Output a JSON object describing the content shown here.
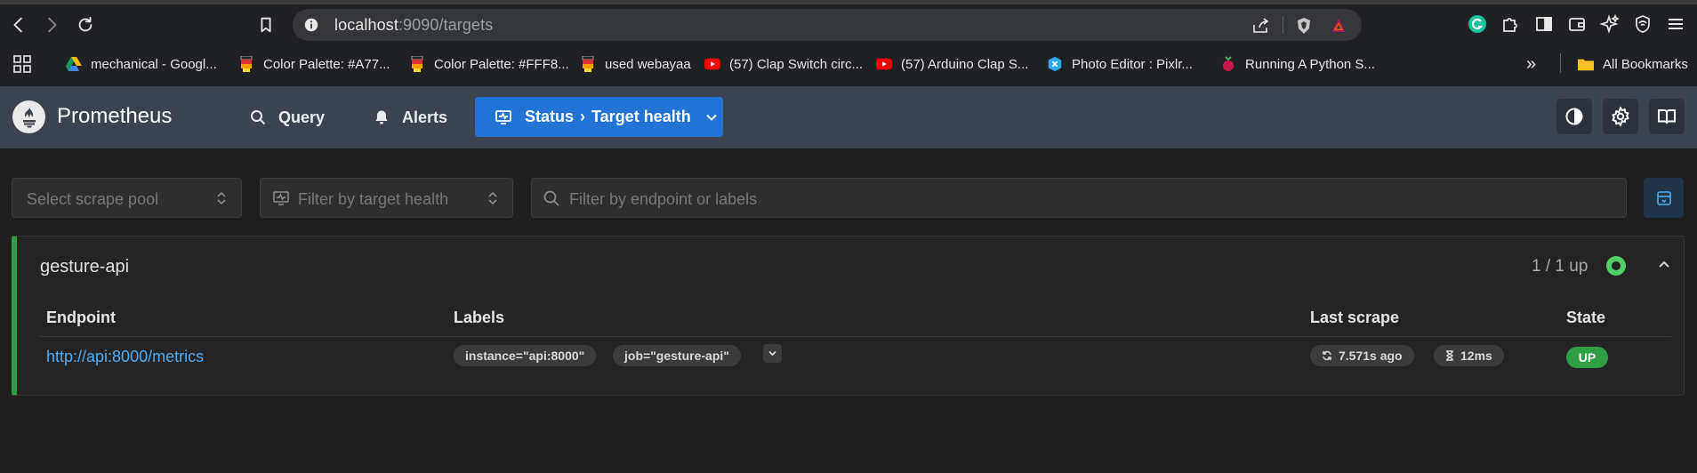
{
  "browser": {
    "url_host": "localhost",
    "url_rest": ":9090/targets",
    "bookmarks": [
      {
        "label": "mechanical - Googl...",
        "icon": "google-drive-icon"
      },
      {
        "label": "Color Palette: #A77...",
        "icon": "palette-icon"
      },
      {
        "label": "Color Palette: #FFF8...",
        "icon": "palette-icon"
      },
      {
        "label": "used webayaa",
        "icon": "palette-icon"
      },
      {
        "label": "(57) Clap Switch circ...",
        "icon": "youtube-icon"
      },
      {
        "label": "(57) Arduino Clap S...",
        "icon": "youtube-icon"
      },
      {
        "label": "Photo Editor : Pixlr...",
        "icon": "pixlr-icon"
      },
      {
        "label": "Running A Python S...",
        "icon": "raspberry-icon"
      }
    ],
    "all_bookmarks_label": "All Bookmarks",
    "colors": {
      "chrome_bg": "#202124",
      "urlbar_bg": "#35363a"
    }
  },
  "app": {
    "brand": "Prometheus",
    "nav": {
      "query": "Query",
      "alerts": "Alerts",
      "status": "Status",
      "status_page": "Target health"
    },
    "colors": {
      "header_bg": "#3b434e",
      "accent": "#2273d6",
      "healthy": "#2f9e44",
      "link": "#4dabf7"
    }
  },
  "filters": {
    "scrape_pool_placeholder": "Select scrape pool",
    "health_placeholder": "Filter by target health",
    "search_placeholder": "Filter by endpoint or labels"
  },
  "pool": {
    "name": "gesture-api",
    "count": "1 / 1 up",
    "columns": {
      "endpoint": "Endpoint",
      "labels": "Labels",
      "last_scrape": "Last scrape",
      "state": "State"
    },
    "targets": [
      {
        "endpoint": "http://api:8000/metrics",
        "labels": [
          "instance=\"api:8000\"",
          "job=\"gesture-api\""
        ],
        "last_scrape": "7.571s ago",
        "duration": "12ms",
        "state": "UP"
      }
    ]
  }
}
